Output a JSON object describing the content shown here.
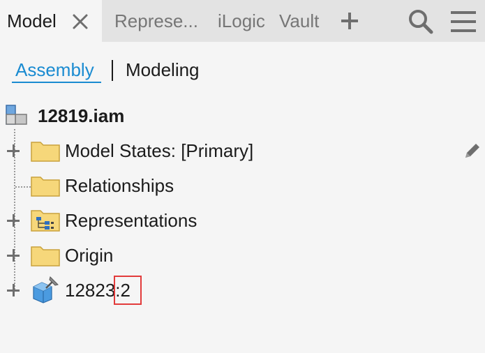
{
  "tabs": {
    "active_label": "Model",
    "inactive": [
      {
        "label": "Represe..."
      },
      {
        "label": "iLogic"
      },
      {
        "label": "Vault"
      }
    ]
  },
  "subtabs": {
    "assembly": "Assembly",
    "modeling": "Modeling"
  },
  "tree": {
    "root": "12819.iam",
    "items": [
      {
        "label": "Model States: [Primary]",
        "icon": "folder-icon"
      },
      {
        "label": "Relationships",
        "icon": "folder-icon"
      },
      {
        "label": "Representations",
        "icon": "representations-folder-icon"
      },
      {
        "label": "Origin",
        "icon": "folder-icon"
      },
      {
        "label": "12823:2",
        "icon": "pinned-part-icon"
      }
    ]
  },
  "colors": {
    "accent": "#1a8bd1",
    "highlight": "#e23b3b",
    "folder": "#f6d77a"
  }
}
